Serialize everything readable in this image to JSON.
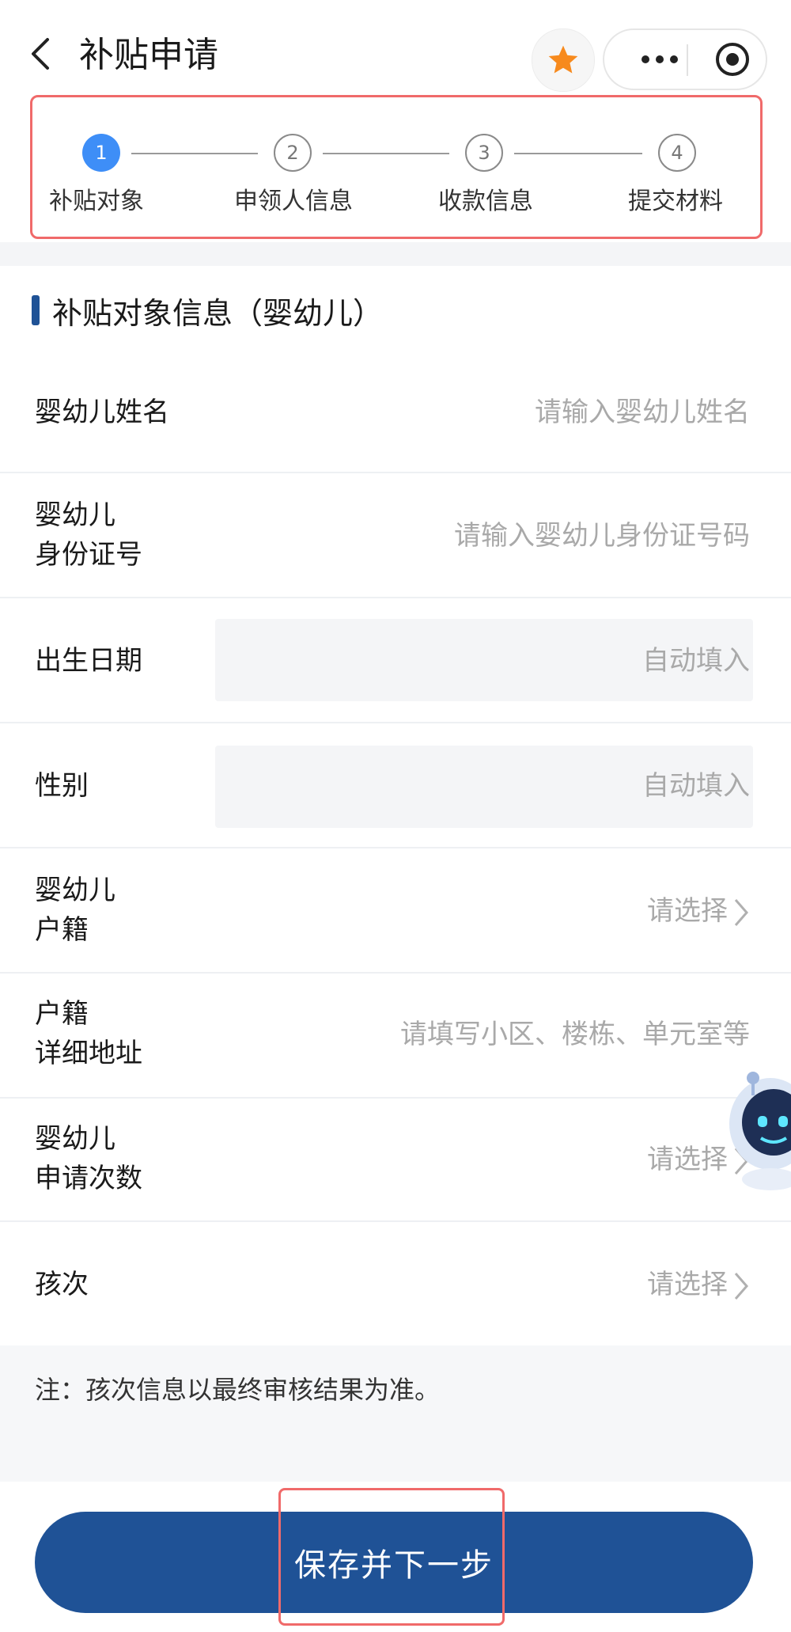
{
  "nav": {
    "title": "补贴申请",
    "back_icon": "chevron-left-icon",
    "favorite_icon": "star-icon",
    "favorite_color": "#f78a1d",
    "more_icon": "more-dots-icon",
    "target_icon": "target-icon"
  },
  "steps": [
    {
      "number": "1",
      "label": "补贴对象",
      "state": "active"
    },
    {
      "number": "2",
      "label": "申领人信息",
      "state": "todo"
    },
    {
      "number": "3",
      "label": "收款信息",
      "state": "todo"
    },
    {
      "number": "4",
      "label": "提交材料",
      "state": "todo"
    }
  ],
  "section": {
    "title": "补贴对象信息（婴幼儿）"
  },
  "fields": {
    "name": {
      "label": "婴幼儿姓名",
      "placeholder": "请输入婴幼儿姓名"
    },
    "id_number": {
      "label_line1": "婴幼儿",
      "label_line2": "身份证号",
      "placeholder": "请输入婴幼儿身份证号码"
    },
    "birth_date": {
      "label": "出生日期",
      "value": "自动填入"
    },
    "gender": {
      "label": "性别",
      "value": "自动填入"
    },
    "household": {
      "label_line1": "婴幼儿",
      "label_line2": "户籍",
      "value": "请选择"
    },
    "address": {
      "label_line1": "户籍",
      "label_line2": "详细地址",
      "placeholder": "请填写小区、楼栋、单元室等"
    },
    "apply_count": {
      "label_line1": "婴幼儿",
      "label_line2": "申请次数",
      "value": "请选择"
    },
    "child_order": {
      "label": "孩次",
      "value": "请选择"
    }
  },
  "note": "注：孩次信息以最终审核结果为准。",
  "footer": {
    "submit_label": "保存并下一步"
  },
  "colors": {
    "primary": "#1f5296",
    "step_active": "#3e8ef7",
    "highlight_border": "#f06a6a"
  }
}
